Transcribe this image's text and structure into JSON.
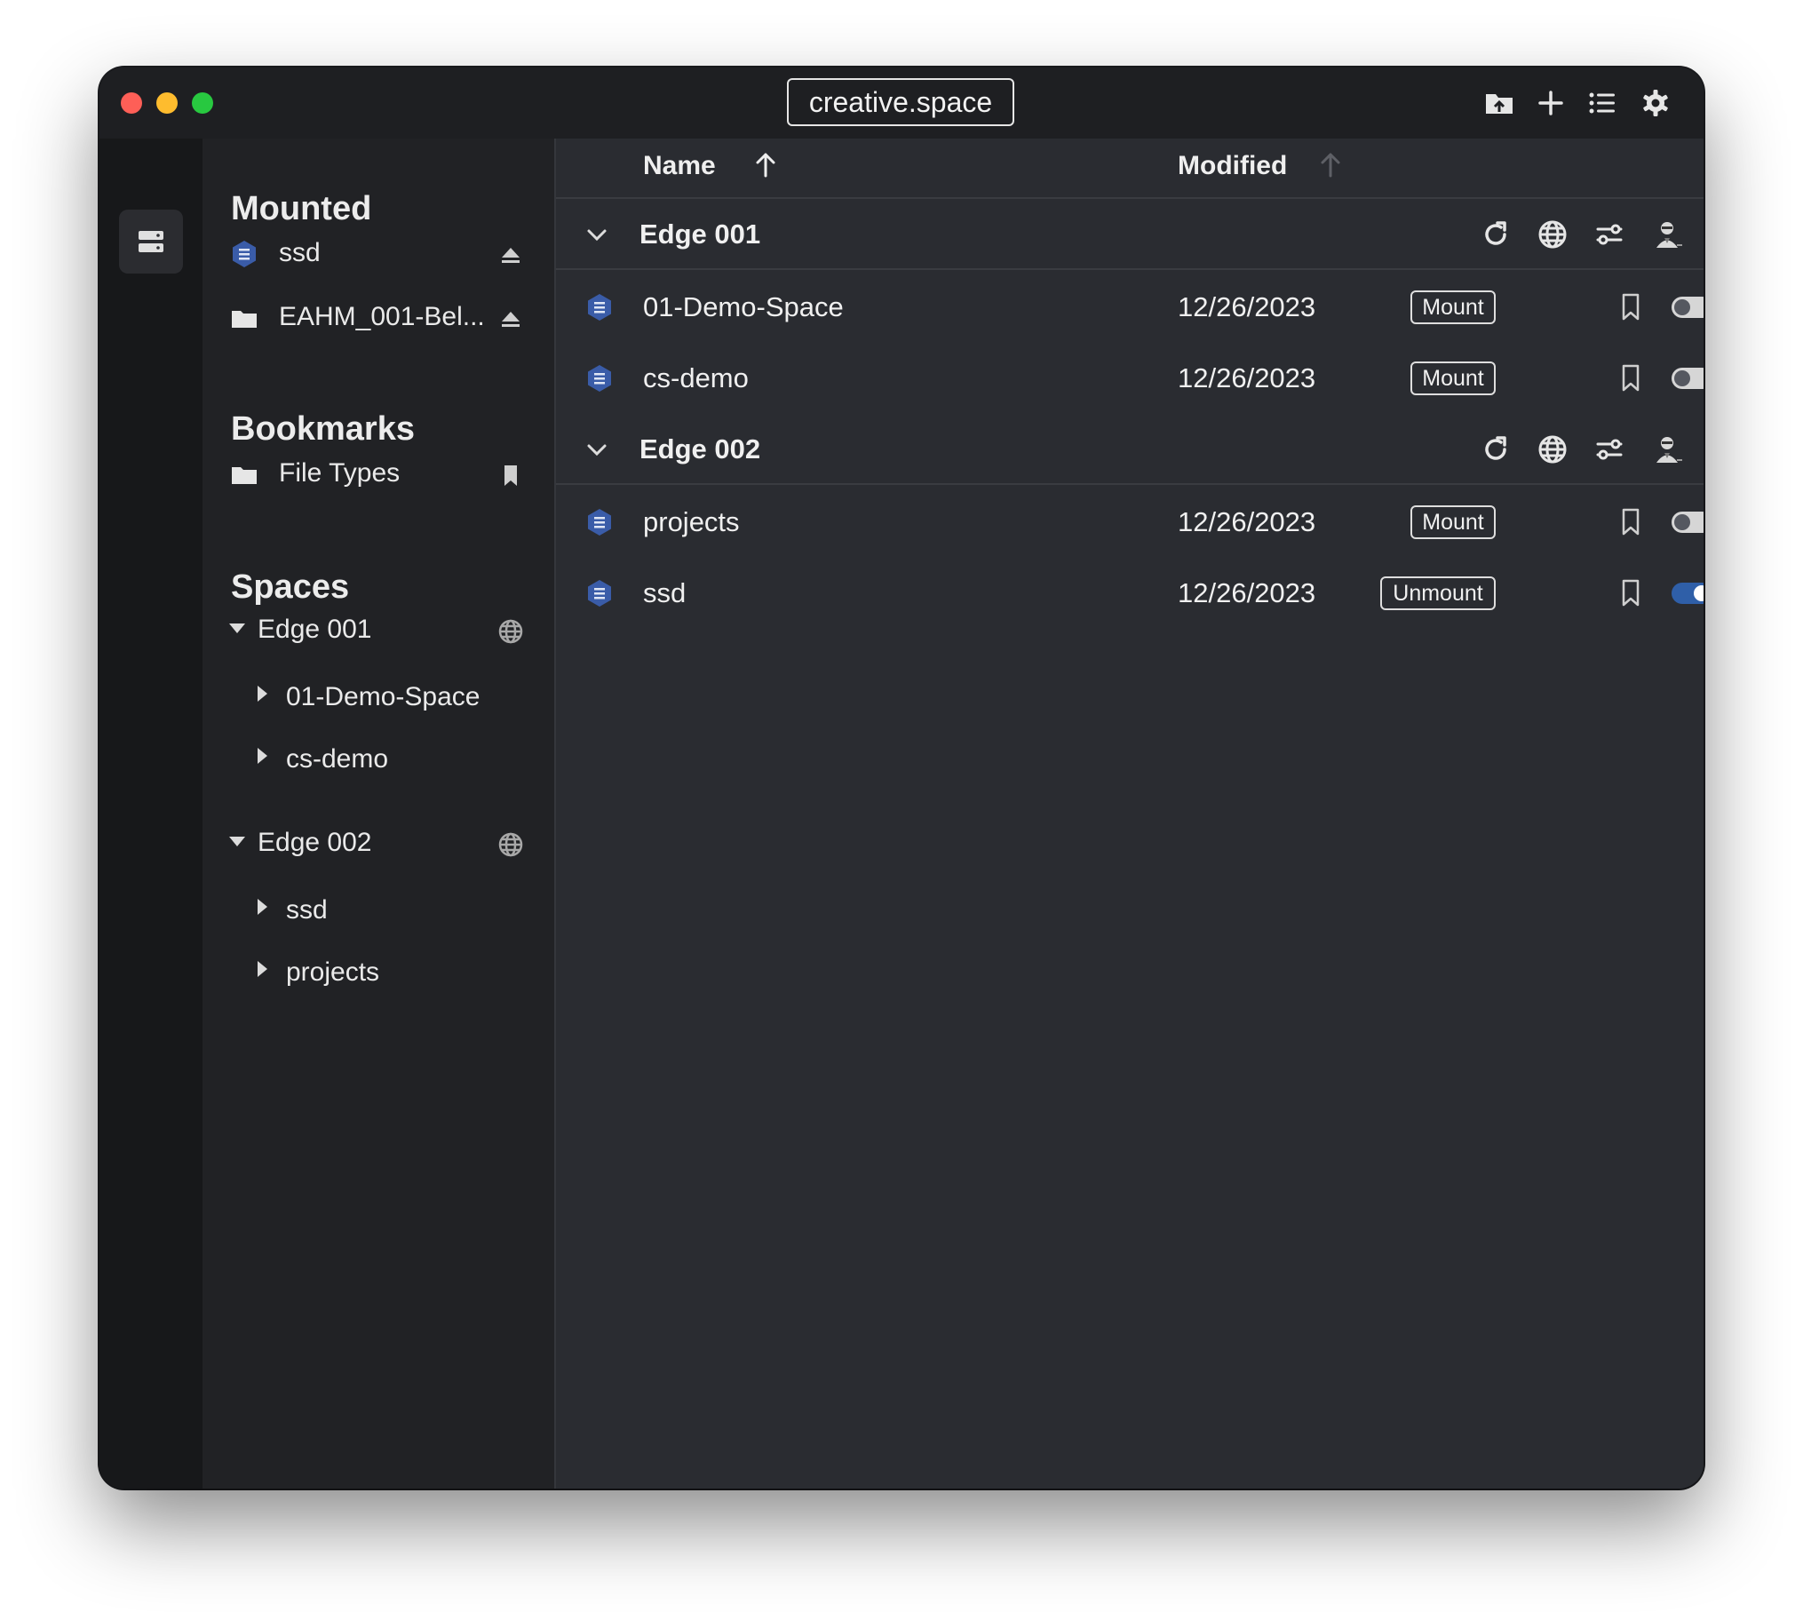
{
  "window": {
    "title": "creative.space"
  },
  "toolbar": {
    "icons": [
      "upload-folder-icon",
      "plus-icon",
      "list-view-icon",
      "gear-icon"
    ]
  },
  "sidebar": {
    "mounted": {
      "title": "Mounted",
      "items": [
        {
          "label": "ssd",
          "icon": "drive-icon",
          "action": "eject-icon"
        },
        {
          "label": "EAHM_001-Bel...",
          "icon": "folder-icon",
          "action": "eject-icon"
        }
      ]
    },
    "bookmarks": {
      "title": "Bookmarks",
      "items": [
        {
          "label": "File Types",
          "icon": "folder-icon",
          "action": "bookmark-icon"
        }
      ]
    },
    "spaces": {
      "title": "Spaces",
      "groups": [
        {
          "label": "Edge 001",
          "children": [
            "01-Demo-Space",
            "cs-demo"
          ]
        },
        {
          "label": "Edge 002",
          "children": [
            "ssd",
            "projects"
          ]
        }
      ]
    }
  },
  "main": {
    "columns": {
      "name": "Name",
      "modified": "Modified"
    },
    "groups": [
      {
        "name": "Edge 001",
        "rows": [
          {
            "name": "01-Demo-Space",
            "modified": "12/26/2023",
            "button": "Mount",
            "mounted": false
          },
          {
            "name": "cs-demo",
            "modified": "12/26/2023",
            "button": "Mount",
            "mounted": false
          }
        ]
      },
      {
        "name": "Edge 002",
        "rows": [
          {
            "name": "projects",
            "modified": "12/26/2023",
            "button": "Mount",
            "mounted": false
          },
          {
            "name": "ssd",
            "modified": "12/26/2023",
            "button": "Unmount",
            "mounted": true
          }
        ]
      }
    ]
  },
  "colors": {
    "accent": "#2f5fa8",
    "drive_icon": "#3a5ca8",
    "window_bg": "#2a2c31",
    "sidebar_bg": "#212225"
  }
}
